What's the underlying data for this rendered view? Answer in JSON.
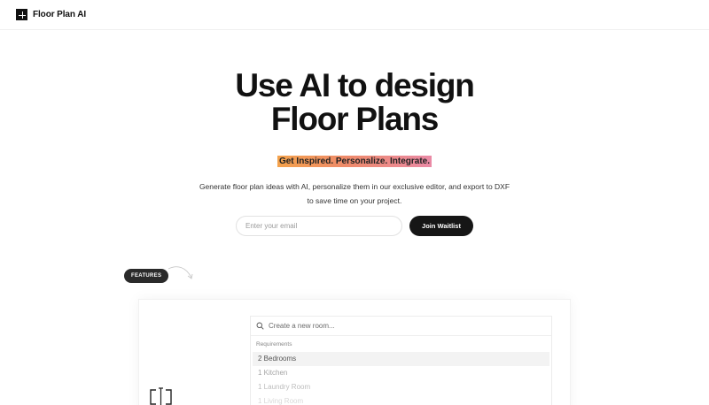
{
  "header": {
    "logo_text": "Floor Plan AI"
  },
  "hero": {
    "title_line1": "Use AI to design",
    "title_line2": "Floor Plans",
    "tagline": "Get Inspired. Personalize. Integrate.",
    "description_line1": "Generate floor plan ideas with AI, personalize them in our exclusive editor, and export to DXF",
    "description_line2": "to save time on your project."
  },
  "waitlist": {
    "email_placeholder": "Enter your email",
    "button_label": "Join Waitlist"
  },
  "features": {
    "badge_label": "FEATURES"
  },
  "room_panel": {
    "search_placeholder": "Create a new room...",
    "requirements_label": "Requirements",
    "items": [
      "2 Bedrooms",
      "1 Kitchen",
      "1 Laundry Room",
      "1 Living Room"
    ],
    "selected_index": 0
  },
  "colors": {
    "accent_start": "#f4a24c",
    "accent_end": "#ea8aa6",
    "button_bg": "#161616"
  },
  "icons": [
    "logo-mark-icon",
    "curved-arrow-icon",
    "search-icon",
    "room-bracket-icon"
  ]
}
